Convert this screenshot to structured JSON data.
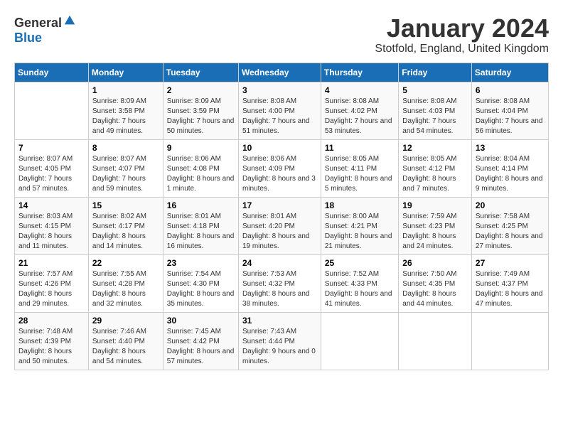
{
  "logo": {
    "general": "General",
    "blue": "Blue"
  },
  "header": {
    "month": "January 2024",
    "location": "Stotfold, England, United Kingdom"
  },
  "days_of_week": [
    "Sunday",
    "Monday",
    "Tuesday",
    "Wednesday",
    "Thursday",
    "Friday",
    "Saturday"
  ],
  "weeks": [
    [
      {
        "day": "",
        "sunrise": "",
        "sunset": "",
        "daylight": ""
      },
      {
        "day": "1",
        "sunrise": "Sunrise: 8:09 AM",
        "sunset": "Sunset: 3:58 PM",
        "daylight": "Daylight: 7 hours and 49 minutes."
      },
      {
        "day": "2",
        "sunrise": "Sunrise: 8:09 AM",
        "sunset": "Sunset: 3:59 PM",
        "daylight": "Daylight: 7 hours and 50 minutes."
      },
      {
        "day": "3",
        "sunrise": "Sunrise: 8:08 AM",
        "sunset": "Sunset: 4:00 PM",
        "daylight": "Daylight: 7 hours and 51 minutes."
      },
      {
        "day": "4",
        "sunrise": "Sunrise: 8:08 AM",
        "sunset": "Sunset: 4:02 PM",
        "daylight": "Daylight: 7 hours and 53 minutes."
      },
      {
        "day": "5",
        "sunrise": "Sunrise: 8:08 AM",
        "sunset": "Sunset: 4:03 PM",
        "daylight": "Daylight: 7 hours and 54 minutes."
      },
      {
        "day": "6",
        "sunrise": "Sunrise: 8:08 AM",
        "sunset": "Sunset: 4:04 PM",
        "daylight": "Daylight: 7 hours and 56 minutes."
      }
    ],
    [
      {
        "day": "7",
        "sunrise": "Sunrise: 8:07 AM",
        "sunset": "Sunset: 4:05 PM",
        "daylight": "Daylight: 7 hours and 57 minutes."
      },
      {
        "day": "8",
        "sunrise": "Sunrise: 8:07 AM",
        "sunset": "Sunset: 4:07 PM",
        "daylight": "Daylight: 7 hours and 59 minutes."
      },
      {
        "day": "9",
        "sunrise": "Sunrise: 8:06 AM",
        "sunset": "Sunset: 4:08 PM",
        "daylight": "Daylight: 8 hours and 1 minute."
      },
      {
        "day": "10",
        "sunrise": "Sunrise: 8:06 AM",
        "sunset": "Sunset: 4:09 PM",
        "daylight": "Daylight: 8 hours and 3 minutes."
      },
      {
        "day": "11",
        "sunrise": "Sunrise: 8:05 AM",
        "sunset": "Sunset: 4:11 PM",
        "daylight": "Daylight: 8 hours and 5 minutes."
      },
      {
        "day": "12",
        "sunrise": "Sunrise: 8:05 AM",
        "sunset": "Sunset: 4:12 PM",
        "daylight": "Daylight: 8 hours and 7 minutes."
      },
      {
        "day": "13",
        "sunrise": "Sunrise: 8:04 AM",
        "sunset": "Sunset: 4:14 PM",
        "daylight": "Daylight: 8 hours and 9 minutes."
      }
    ],
    [
      {
        "day": "14",
        "sunrise": "Sunrise: 8:03 AM",
        "sunset": "Sunset: 4:15 PM",
        "daylight": "Daylight: 8 hours and 11 minutes."
      },
      {
        "day": "15",
        "sunrise": "Sunrise: 8:02 AM",
        "sunset": "Sunset: 4:17 PM",
        "daylight": "Daylight: 8 hours and 14 minutes."
      },
      {
        "day": "16",
        "sunrise": "Sunrise: 8:01 AM",
        "sunset": "Sunset: 4:18 PM",
        "daylight": "Daylight: 8 hours and 16 minutes."
      },
      {
        "day": "17",
        "sunrise": "Sunrise: 8:01 AM",
        "sunset": "Sunset: 4:20 PM",
        "daylight": "Daylight: 8 hours and 19 minutes."
      },
      {
        "day": "18",
        "sunrise": "Sunrise: 8:00 AM",
        "sunset": "Sunset: 4:21 PM",
        "daylight": "Daylight: 8 hours and 21 minutes."
      },
      {
        "day": "19",
        "sunrise": "Sunrise: 7:59 AM",
        "sunset": "Sunset: 4:23 PM",
        "daylight": "Daylight: 8 hours and 24 minutes."
      },
      {
        "day": "20",
        "sunrise": "Sunrise: 7:58 AM",
        "sunset": "Sunset: 4:25 PM",
        "daylight": "Daylight: 8 hours and 27 minutes."
      }
    ],
    [
      {
        "day": "21",
        "sunrise": "Sunrise: 7:57 AM",
        "sunset": "Sunset: 4:26 PM",
        "daylight": "Daylight: 8 hours and 29 minutes."
      },
      {
        "day": "22",
        "sunrise": "Sunrise: 7:55 AM",
        "sunset": "Sunset: 4:28 PM",
        "daylight": "Daylight: 8 hours and 32 minutes."
      },
      {
        "day": "23",
        "sunrise": "Sunrise: 7:54 AM",
        "sunset": "Sunset: 4:30 PM",
        "daylight": "Daylight: 8 hours and 35 minutes."
      },
      {
        "day": "24",
        "sunrise": "Sunrise: 7:53 AM",
        "sunset": "Sunset: 4:32 PM",
        "daylight": "Daylight: 8 hours and 38 minutes."
      },
      {
        "day": "25",
        "sunrise": "Sunrise: 7:52 AM",
        "sunset": "Sunset: 4:33 PM",
        "daylight": "Daylight: 8 hours and 41 minutes."
      },
      {
        "day": "26",
        "sunrise": "Sunrise: 7:50 AM",
        "sunset": "Sunset: 4:35 PM",
        "daylight": "Daylight: 8 hours and 44 minutes."
      },
      {
        "day": "27",
        "sunrise": "Sunrise: 7:49 AM",
        "sunset": "Sunset: 4:37 PM",
        "daylight": "Daylight: 8 hours and 47 minutes."
      }
    ],
    [
      {
        "day": "28",
        "sunrise": "Sunrise: 7:48 AM",
        "sunset": "Sunset: 4:39 PM",
        "daylight": "Daylight: 8 hours and 50 minutes."
      },
      {
        "day": "29",
        "sunrise": "Sunrise: 7:46 AM",
        "sunset": "Sunset: 4:40 PM",
        "daylight": "Daylight: 8 hours and 54 minutes."
      },
      {
        "day": "30",
        "sunrise": "Sunrise: 7:45 AM",
        "sunset": "Sunset: 4:42 PM",
        "daylight": "Daylight: 8 hours and 57 minutes."
      },
      {
        "day": "31",
        "sunrise": "Sunrise: 7:43 AM",
        "sunset": "Sunset: 4:44 PM",
        "daylight": "Daylight: 9 hours and 0 minutes."
      },
      {
        "day": "",
        "sunrise": "",
        "sunset": "",
        "daylight": ""
      },
      {
        "day": "",
        "sunrise": "",
        "sunset": "",
        "daylight": ""
      },
      {
        "day": "",
        "sunrise": "",
        "sunset": "",
        "daylight": ""
      }
    ]
  ]
}
